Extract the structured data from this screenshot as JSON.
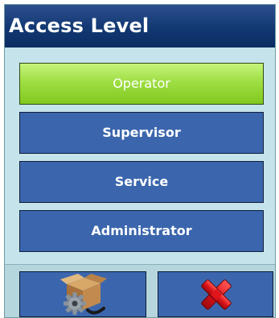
{
  "dialog": {
    "title": "Access Level"
  },
  "options": [
    {
      "label": "Operator",
      "selected": true
    },
    {
      "label": "Supervisor",
      "selected": false
    },
    {
      "label": "Service",
      "selected": false
    },
    {
      "label": "Administrator",
      "selected": false
    }
  ],
  "footer": {
    "buttons": [
      {
        "icon": "setup-box-gear-icon"
      },
      {
        "icon": "cancel-x-icon"
      }
    ]
  },
  "colors": {
    "title_bar": "#123872",
    "option_bg": "#3b66ad",
    "selected_bg": "#9fde44",
    "panel_bg": "#c4e3ea",
    "cancel_red": "#e0141b"
  }
}
